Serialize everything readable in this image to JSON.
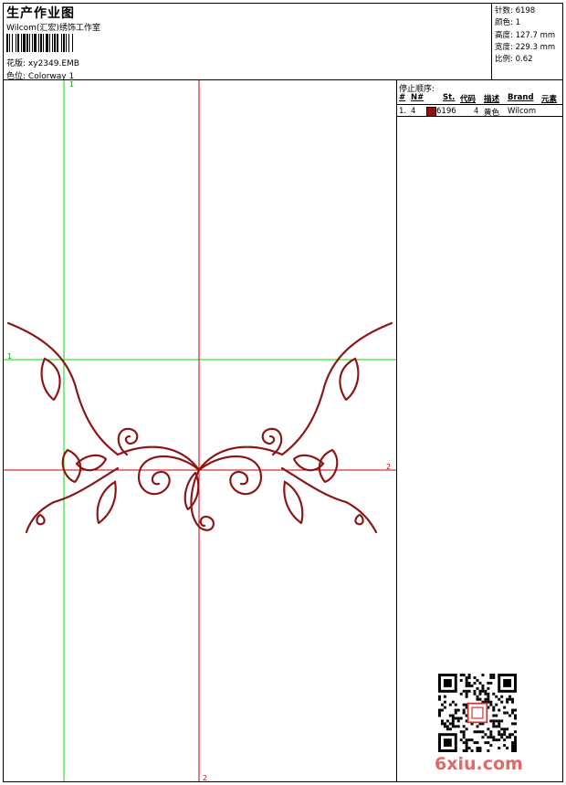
{
  "header": {
    "title": "生产作业图",
    "company": "Wilcom(汇宏)绣饰工作室",
    "design_label": "花版:",
    "design_value": "xy2349.EMB",
    "colorway_label": "色位:",
    "colorway_value": "Colorway 1"
  },
  "stats": [
    {
      "label": "针数:",
      "value": "6198"
    },
    {
      "label": "颜色:",
      "value": "1"
    },
    {
      "label": "高度:",
      "value": "127.7 mm"
    },
    {
      "label": "宽度:",
      "value": "229.3 mm"
    },
    {
      "label": "比例:",
      "value": "0.62"
    }
  ],
  "stop_sequence": {
    "title": "停止顺序:",
    "columns": [
      "#",
      "N#",
      "St.",
      "代码",
      "描述",
      "Brand",
      "元素"
    ],
    "rows": [
      {
        "index": "1.",
        "needle": "4",
        "color": "#8b1414",
        "stitches": "6196",
        "code": "4",
        "description": "黄色",
        "brand": "Wilcom"
      }
    ]
  },
  "guides": {
    "green_top": "1",
    "green_left": "1",
    "red_right": "2",
    "red_bottom": "2"
  },
  "colors": {
    "thread": "#8b1414",
    "guide_green": "#00dd00",
    "guide_red": "#cc0000"
  },
  "watermark": "6xiu.com"
}
